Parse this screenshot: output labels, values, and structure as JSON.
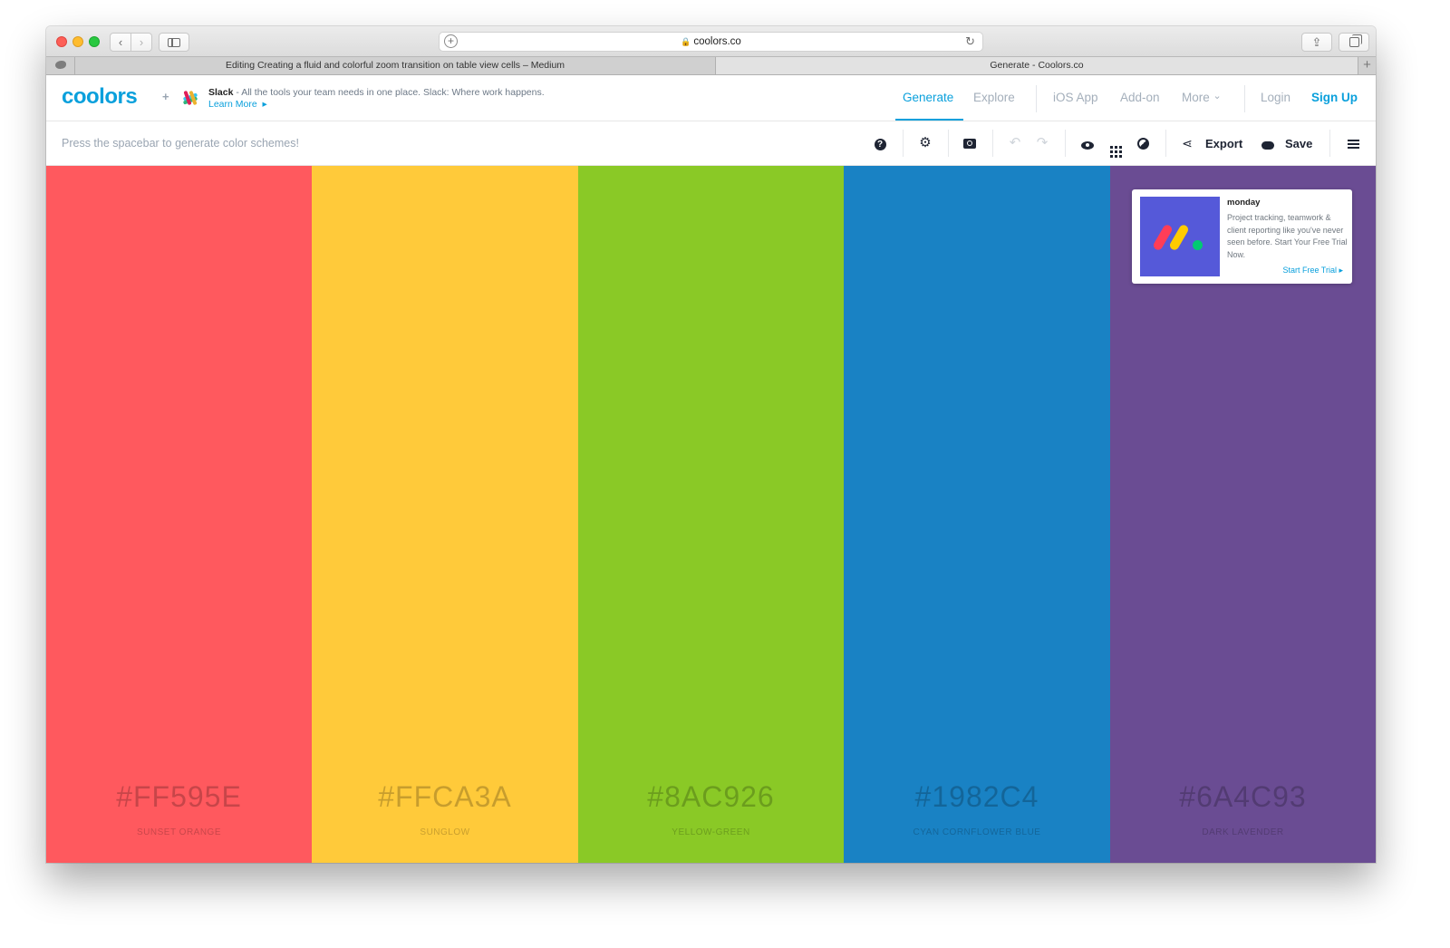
{
  "browser": {
    "url": "coolors.co",
    "tabs": [
      {
        "title": "Editing Creating a fluid and colorful zoom transition on table view cells – Medium"
      },
      {
        "title": "Generate - Coolors.co"
      }
    ]
  },
  "header": {
    "logo": "coolors",
    "plus": "+",
    "sponsor": {
      "name": "Slack",
      "text": " - All the tools your team needs in one place. Slack: Where work happens. ",
      "link": "Learn More",
      "arrow": "▸"
    },
    "nav": {
      "generate": "Generate",
      "explore": "Explore",
      "ios_app": "iOS App",
      "addon": "Add-on",
      "more": "More",
      "more_caret": "⌄",
      "login": "Login",
      "signup": "Sign Up"
    }
  },
  "toolbar": {
    "hint": "Press the spacebar to generate color schemes!",
    "help_glyph": "?",
    "settings_glyph": "⚙",
    "undo_glyph": "↶",
    "redo_glyph": "↷",
    "share_glyph": "⋖",
    "export": "Export",
    "save": "Save"
  },
  "palette": [
    {
      "hex": "#FF595E",
      "name": "SUNSET ORANGE",
      "color": "#FF595E"
    },
    {
      "hex": "#FFCA3A",
      "name": "SUNGLOW",
      "color": "#FFCA3A"
    },
    {
      "hex": "#8AC926",
      "name": "YELLOW-GREEN",
      "color": "#8AC926"
    },
    {
      "hex": "#1982C4",
      "name": "CYAN CORNFLOWER BLUE",
      "color": "#1982C4"
    },
    {
      "hex": "#6A4C93",
      "name": "DARK LAVENDER",
      "color": "#6A4C93"
    }
  ],
  "ad": {
    "brand": "monday",
    "description": "Project tracking, teamwork & client reporting like you've never seen before. Start Your Free Trial Now.",
    "cta": "Start Free Trial ▸"
  },
  "colors": {
    "accent": "#0aa0dc",
    "nav_inactive": "#a4afbb",
    "toolbar_icon": "#1e2433"
  }
}
